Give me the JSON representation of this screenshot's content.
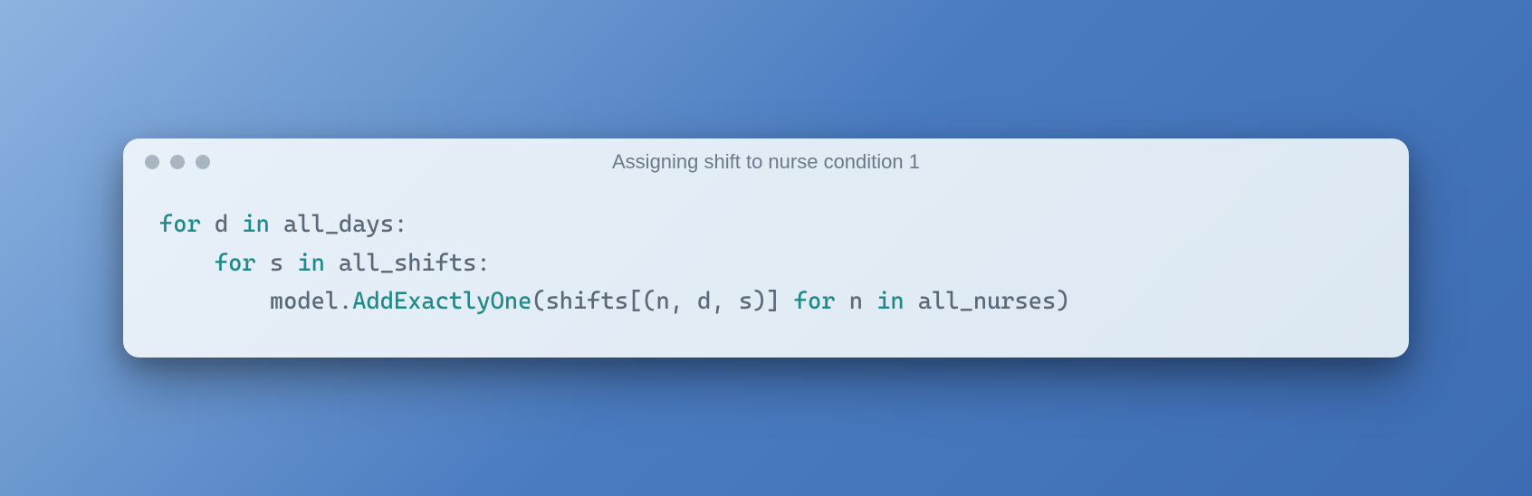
{
  "window": {
    "title": "Assigning shift to nurse condition 1"
  },
  "code": {
    "line1": {
      "kw_for": "for",
      "var_d": " d ",
      "kw_in": "in",
      "rest": " all_days:"
    },
    "line2": {
      "indent": "    ",
      "kw_for": "for",
      "var_s": " s ",
      "kw_in": "in",
      "rest": " all_shifts:"
    },
    "line3": {
      "indent": "        ",
      "obj": "model.",
      "fn": "AddExactlyOne",
      "args_open": "(shifts[(n, d, s)] ",
      "kw_for": "for",
      "var_n": " n ",
      "kw_in": "in",
      "rest": " all_nurses)"
    }
  }
}
